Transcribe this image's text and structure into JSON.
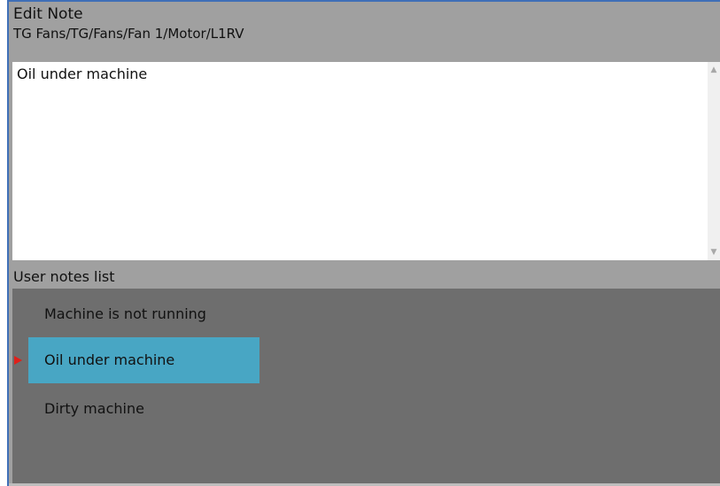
{
  "dialog": {
    "title": "Edit Note",
    "path": "TG Fans/TG/Fans/Fan 1/Motor/L1RV"
  },
  "editor": {
    "value": "Oil under machine",
    "scroll_up_icon": "chevron-up-icon",
    "scroll_down_icon": "chevron-down-icon"
  },
  "notes_list": {
    "label": "User notes list",
    "items": [
      {
        "label": "Machine is not running",
        "selected": false
      },
      {
        "label": "Oil under machine",
        "selected": true
      },
      {
        "label": "Dirty machine",
        "selected": false
      }
    ]
  },
  "colors": {
    "accent_border": "#3f6fb7",
    "selection": "#48a6c4",
    "list_background": "#6e6e6e",
    "marker": "#e0201a"
  }
}
